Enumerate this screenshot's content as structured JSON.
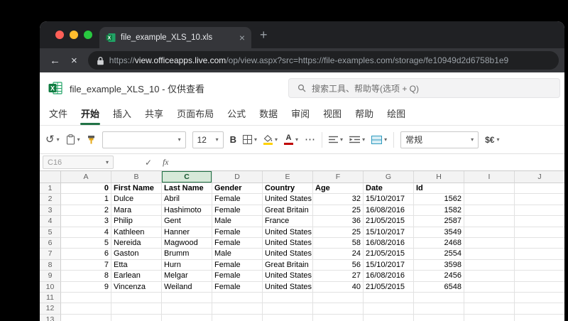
{
  "icons": {
    "back": "←",
    "stop": "×",
    "tab_close": "×",
    "new_tab": "+",
    "undo": "↺",
    "chevron": "▾",
    "more": "⋯",
    "check": "✓"
  },
  "browser": {
    "tab_title": "file_example_XLS_10.xls",
    "url_prefix": "https://",
    "url_domain": "view.officeapps.live.com",
    "url_path": "/op/view.aspx?src=https://file-examples.com/storage/fe10949d2d6758b1e9"
  },
  "app": {
    "doc_title": "file_example_XLS_10 - 仅供查看",
    "search_placeholder": "搜索工具、帮助等(选项 + Q)",
    "menu_items": [
      "文件",
      "开始",
      "插入",
      "共享",
      "页面布局",
      "公式",
      "数据",
      "审阅",
      "视图",
      "帮助",
      "绘图"
    ],
    "active_menu_index": 1
  },
  "toolbar": {
    "font_name": "",
    "font_size": "12",
    "bold_label": "B",
    "font_color_label": "A",
    "number_format": "常规",
    "currency_label": "$€"
  },
  "formula_bar": {
    "cell_ref": "C16",
    "fx_label": "fx"
  },
  "sheet": {
    "selected_column": "C",
    "columns": [
      "A",
      "B",
      "C",
      "D",
      "E",
      "F",
      "G",
      "H",
      "I",
      "J"
    ],
    "rows": [
      [
        "0",
        "First Name",
        "Last Name",
        "Gender",
        "Country",
        "Age",
        "Date",
        "Id",
        "",
        ""
      ],
      [
        "1",
        "Dulce",
        "Abril",
        "Female",
        "United States",
        "32",
        "15/10/2017",
        "1562",
        "",
        ""
      ],
      [
        "2",
        "Mara",
        "Hashimoto",
        "Female",
        "Great Britain",
        "25",
        "16/08/2016",
        "1582",
        "",
        ""
      ],
      [
        "3",
        "Philip",
        "Gent",
        "Male",
        "France",
        "36",
        "21/05/2015",
        "2587",
        "",
        ""
      ],
      [
        "4",
        "Kathleen",
        "Hanner",
        "Female",
        "United States",
        "25",
        "15/10/2017",
        "3549",
        "",
        ""
      ],
      [
        "5",
        "Nereida",
        "Magwood",
        "Female",
        "United States",
        "58",
        "16/08/2016",
        "2468",
        "",
        ""
      ],
      [
        "6",
        "Gaston",
        "Brumm",
        "Male",
        "United States",
        "24",
        "21/05/2015",
        "2554",
        "",
        ""
      ],
      [
        "7",
        "Etta",
        "Hurn",
        "Female",
        "Great Britain",
        "56",
        "15/10/2017",
        "3598",
        "",
        ""
      ],
      [
        "8",
        "Earlean",
        "Melgar",
        "Female",
        "United States",
        "27",
        "16/08/2016",
        "2456",
        "",
        ""
      ],
      [
        "9",
        "Vincenza",
        "Weiland",
        "Female",
        "United States",
        "40",
        "21/05/2015",
        "6548",
        "",
        ""
      ],
      [
        "",
        "",
        "",
        "",
        "",
        "",
        "",
        "",
        "",
        ""
      ],
      [
        "",
        "",
        "",
        "",
        "",
        "",
        "",
        "",
        "",
        ""
      ],
      [
        "",
        "",
        "",
        "",
        "",
        "",
        "",
        "",
        "",
        ""
      ]
    ]
  },
  "colors": {
    "excel_green": "#107c41",
    "accent_underline": "#217346",
    "font_color_red": "#c00000",
    "fill_yellow": "#ffd100"
  }
}
